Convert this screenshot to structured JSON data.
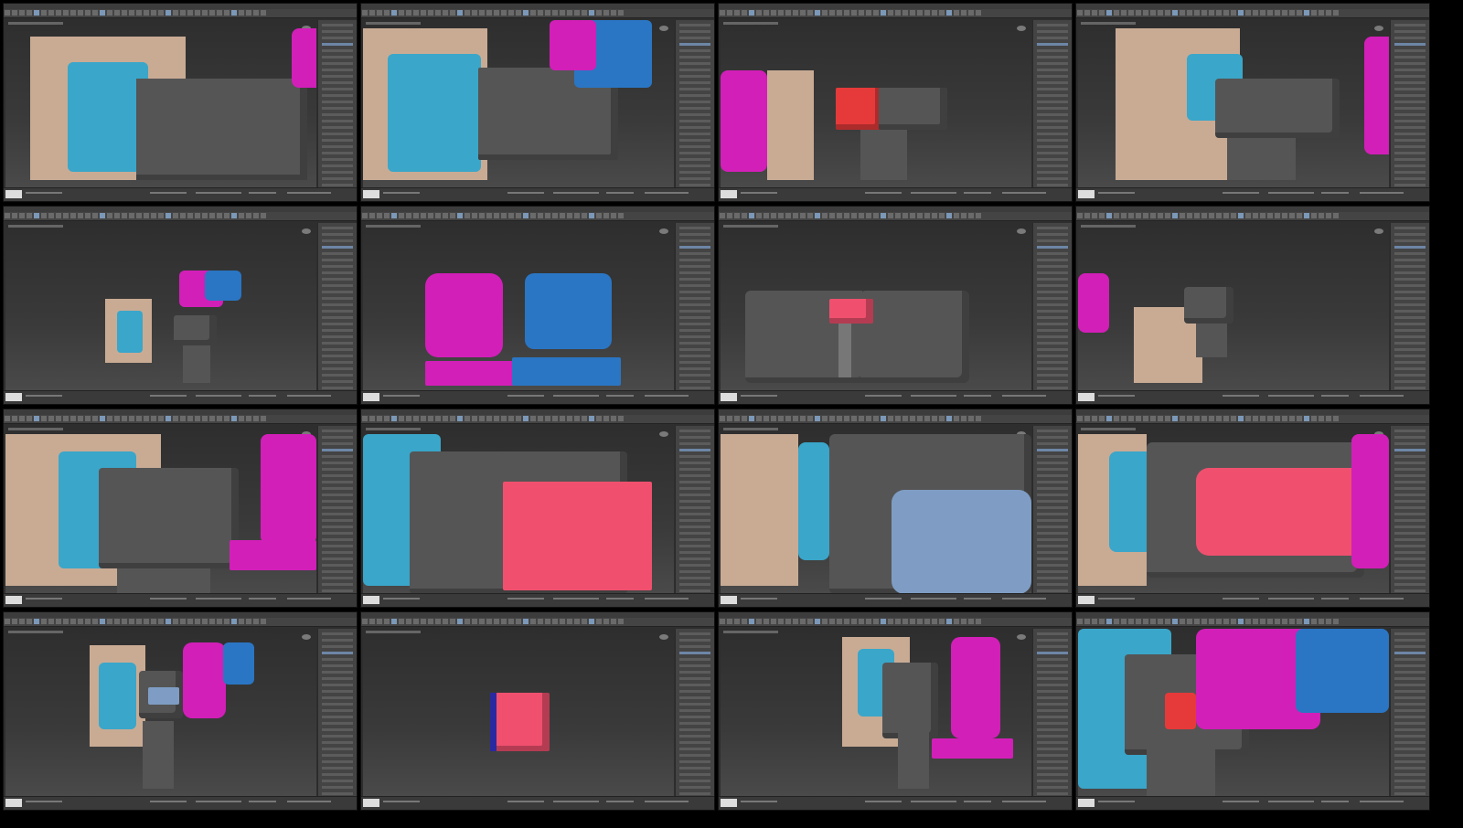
{
  "grid": {
    "columns": 4,
    "rows": 4
  },
  "colors": {
    "viewport_bg": "#2e2e2e",
    "ui_panel": "#444444",
    "object_gray": "#555555",
    "robot_cyan": "#3aa6c9",
    "robot_magenta": "#d21fb8",
    "robot_blue": "#2a76c4",
    "highlight_pink": "#f0506e",
    "highlight_red": "#e63a3a",
    "screen_blue": "#7f9dc4",
    "backdrop_beige": "#c9ab94"
  }
}
